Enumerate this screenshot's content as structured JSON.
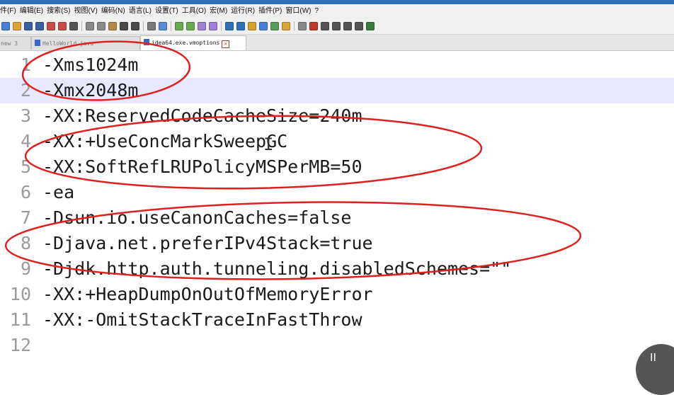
{
  "menu": [
    "件(F)",
    "编辑(E)",
    "搜索(S)",
    "视图(V)",
    "编码(N)",
    "语言(L)",
    "设置(T)",
    "工具(O)",
    "宏(M)",
    "运行(R)",
    "插件(P)",
    "窗口(W)",
    "?"
  ],
  "toolbar": {
    "icons": [
      "new-file-icon",
      "open-file-icon",
      "save-icon",
      "save-all-icon",
      "close-icon",
      "close-all-icon",
      "print-icon",
      "cut-icon",
      "copy-icon",
      "paste-icon",
      "undo-icon",
      "redo-icon",
      "find-icon",
      "replace-icon",
      "zoom-in-icon",
      "zoom-out-icon",
      "sync-v-icon",
      "sync-h-icon",
      "word-wrap-icon",
      "show-all-chars-icon",
      "indent-guide-icon",
      "doc-map-icon",
      "function-list-icon",
      "folder-workspace-icon",
      "monitoring-icon",
      "record-macro-icon",
      "stop-macro-icon",
      "play-macro-icon",
      "run-macro-icon",
      "save-macro-icon",
      "spellcheck-icon"
    ],
    "colors": [
      "#4a7fd6",
      "#d9a43a",
      "#3a5fa0",
      "#3a5fa0",
      "#c94c4c",
      "#c94c4c",
      "#555555",
      "#888888",
      "#8a8a8a",
      "#b08a4a",
      "#4a4a4a",
      "#4a4a4a",
      "#7a7a7a",
      "#5a8ad6",
      "#6aa84f",
      "#6aa84f",
      "#9f7fd0",
      "#9f7fd0",
      "#2f6fb5",
      "#2f6fb5",
      "#d8a030",
      "#4a7fd6",
      "#5a9a5a",
      "#d9a43a",
      "#888888",
      "#c0392b",
      "#555555",
      "#555555",
      "#555555",
      "#555555",
      "#3b7a3b"
    ]
  },
  "tabs": [
    {
      "label": "new 3",
      "active": false
    },
    {
      "label": "HelloWorld.java",
      "active": false
    },
    {
      "label": "idea64.exe.vmoptions",
      "active": true
    }
  ],
  "editor": {
    "highlighted_line": 2,
    "lines": [
      {
        "num": "1",
        "text": "-Xms1024m"
      },
      {
        "num": "2",
        "text": "-Xmx2048m"
      },
      {
        "num": "3",
        "text": "-XX:ReservedCodeCacheSize=240m"
      },
      {
        "num": "4",
        "text": "-XX:+UseConcMarkSweepGC"
      },
      {
        "num": "5",
        "text": "-XX:SoftRefLRUPolicyMSPerMB=50"
      },
      {
        "num": "6",
        "text": "-ea"
      },
      {
        "num": "7",
        "text": "-Dsun.io.useCanonCaches=false"
      },
      {
        "num": "8",
        "text": "-Djava.net.preferIPv4Stack=true"
      },
      {
        "num": "9",
        "text": "-Djdk.http.auth.tunneling.disabledSchemes=\"\""
      },
      {
        "num": "10",
        "text": "-XX:+HeapDumpOnOutOfMemoryError"
      },
      {
        "num": "11",
        "text": "-XX:-OmitStackTraceInFastThrow"
      },
      {
        "num": "12",
        "text": ""
      }
    ]
  },
  "annotation_color": "#e02020",
  "overlay_button": {
    "label": "II"
  }
}
